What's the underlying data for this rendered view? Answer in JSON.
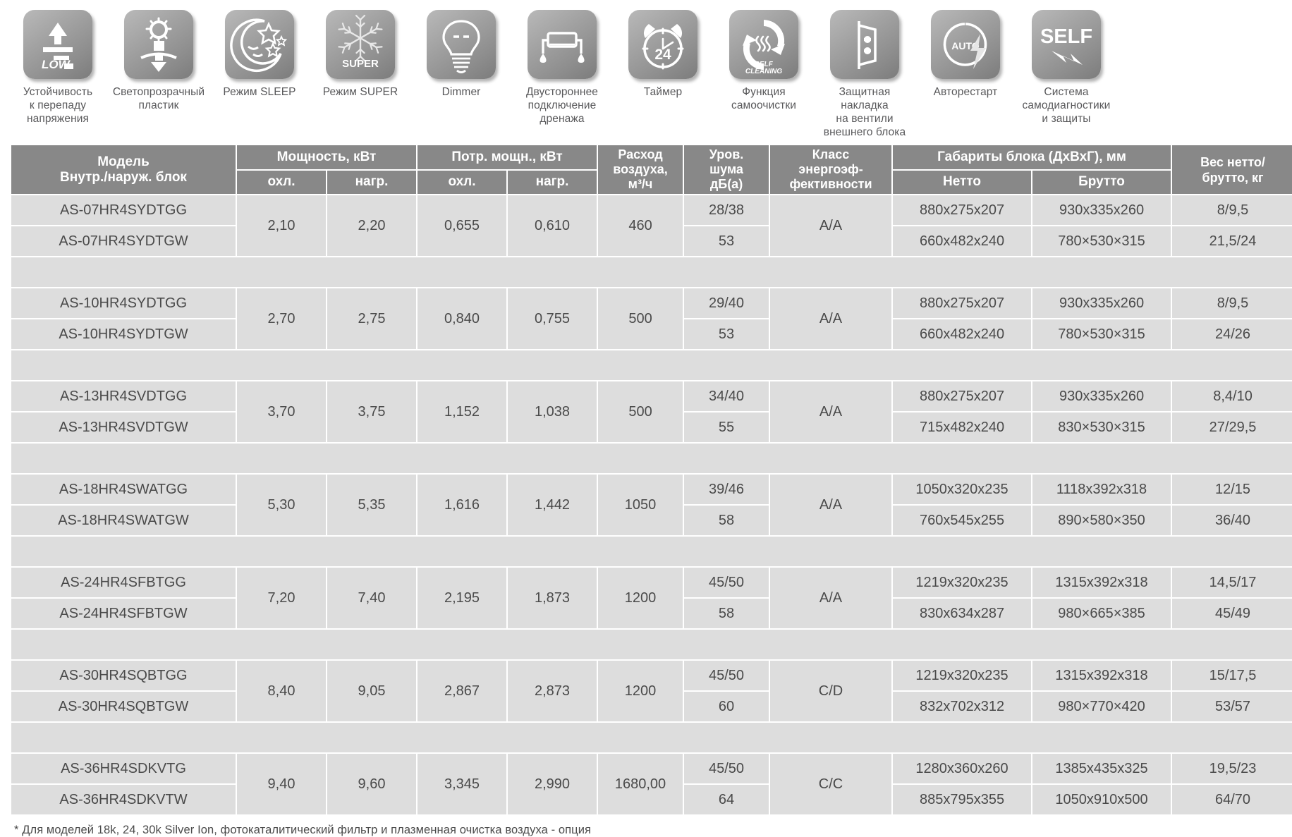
{
  "features": [
    {
      "icon": "voltage-stability-icon",
      "label": "Устойчивость\nк перепаду\nнапряжения"
    },
    {
      "icon": "translucent-plastic-icon",
      "label": "Светопрозрачный\nпластик"
    },
    {
      "icon": "sleep-mode-icon",
      "label": "Режим SLEEP"
    },
    {
      "icon": "super-mode-icon",
      "label": "Режим SUPER"
    },
    {
      "icon": "dimmer-icon",
      "label": "Dimmer"
    },
    {
      "icon": "two-sided-drainage-icon",
      "label": "Двустороннее\nподключение\nдренажа"
    },
    {
      "icon": "timer-icon",
      "label": "Таймер"
    },
    {
      "icon": "self-cleaning-icon",
      "label": "Функция\nсамоочистки"
    },
    {
      "icon": "valve-cover-icon",
      "label": "Защитная накладка\nна вентили\nвнешнего блока"
    },
    {
      "icon": "auto-restart-icon",
      "label": "Авторестарт"
    },
    {
      "icon": "self-diagnostics-icon",
      "label": "Система\nсамодиагностики\nи защиты"
    }
  ],
  "icon_text": {
    "low": "LOW",
    "super": "SUPER",
    "timer": "24",
    "self_cleaning_1": "SELF",
    "self_cleaning_2": "CLEANING",
    "auto": "AUTO",
    "self": "SELF"
  },
  "table": {
    "headers": {
      "model": "Модель\nВнутр./наруж. блок",
      "power": "Мощность, кВт",
      "consumption": "Потр. мощн., кВт",
      "airflow": "Расход\nвоздуха,\nм³/ч",
      "noise": "Уров.\nшума\nдБ(а)",
      "energy_class": "Класс\nэнергоэф-\nфективности",
      "dimensions": "Габариты блока (ДхВхГ), мм",
      "weight": "Вес нетто/\nбрутто, кг",
      "cool_1": "охл.",
      "heat_1": "нагр.",
      "cool_2": "охл.",
      "heat_2": "нагр.",
      "net": "Нетто",
      "gross": "Брутто"
    },
    "rows": [
      {
        "model_indoor": "AS-07HR4SYDTGG",
        "model_outdoor": "AS-07HR4SYDTGW",
        "power_cool": "2,10",
        "power_heat": "2,20",
        "cons_cool": "0,655",
        "cons_heat": "0,610",
        "airflow": "460",
        "noise_indoor": "28/38",
        "noise_outdoor": "53",
        "energy_class": "A/A",
        "net_indoor": "880x275x207",
        "net_outdoor": "660x482x240",
        "gross_indoor": "930x335x260",
        "gross_outdoor": "780×530×315",
        "weight_indoor": "8/9,5",
        "weight_outdoor": "21,5/24"
      },
      {
        "model_indoor": "AS-10HR4SYDTGG",
        "model_outdoor": "AS-10HR4SYDTGW",
        "power_cool": "2,70",
        "power_heat": "2,75",
        "cons_cool": "0,840",
        "cons_heat": "0,755",
        "airflow": "500",
        "noise_indoor": "29/40",
        "noise_outdoor": "53",
        "energy_class": "A/A",
        "net_indoor": "880x275x207",
        "net_outdoor": "660x482x240",
        "gross_indoor": "930x335x260",
        "gross_outdoor": "780×530×315",
        "weight_indoor": "8/9,5",
        "weight_outdoor": "24/26"
      },
      {
        "model_indoor": "AS-13HR4SVDTGG",
        "model_outdoor": "AS-13HR4SVDTGW",
        "power_cool": "3,70",
        "power_heat": "3,75",
        "cons_cool": "1,152",
        "cons_heat": "1,038",
        "airflow": "500",
        "noise_indoor": "34/40",
        "noise_outdoor": "55",
        "energy_class": "A/A",
        "net_indoor": "880x275x207",
        "net_outdoor": "715x482x240",
        "gross_indoor": "930x335x260",
        "gross_outdoor": "830×530×315",
        "weight_indoor": "8,4/10",
        "weight_outdoor": "27/29,5"
      },
      {
        "model_indoor": "AS-18HR4SWATGG",
        "model_outdoor": "AS-18HR4SWATGW",
        "power_cool": "5,30",
        "power_heat": "5,35",
        "cons_cool": "1,616",
        "cons_heat": "1,442",
        "airflow": "1050",
        "noise_indoor": "39/46",
        "noise_outdoor": "58",
        "energy_class": "A/A",
        "net_indoor": "1050x320x235",
        "net_outdoor": "760x545x255",
        "gross_indoor": "1118x392x318",
        "gross_outdoor": "890×580×350",
        "weight_indoor": "12/15",
        "weight_outdoor": "36/40"
      },
      {
        "model_indoor": "AS-24HR4SFBTGG",
        "model_outdoor": "AS-24HR4SFBTGW",
        "power_cool": "7,20",
        "power_heat": "7,40",
        "cons_cool": "2,195",
        "cons_heat": "1,873",
        "airflow": "1200",
        "noise_indoor": "45/50",
        "noise_outdoor": "58",
        "energy_class": "A/A",
        "net_indoor": "1219x320x235",
        "net_outdoor": "830x634x287",
        "gross_indoor": "1315x392x318",
        "gross_outdoor": "980×665×385",
        "weight_indoor": "14,5/17",
        "weight_outdoor": "45/49"
      },
      {
        "model_indoor": "AS-30HR4SQBTGG",
        "model_outdoor": "AS-30HR4SQBTGW",
        "power_cool": "8,40",
        "power_heat": "9,05",
        "cons_cool": "2,867",
        "cons_heat": "2,873",
        "airflow": "1200",
        "noise_indoor": "45/50",
        "noise_outdoor": "60",
        "energy_class": "C/D",
        "net_indoor": "1219x320x235",
        "net_outdoor": "832x702x312",
        "gross_indoor": "1315x392x318",
        "gross_outdoor": "980×770×420",
        "weight_indoor": "15/17,5",
        "weight_outdoor": "53/57"
      },
      {
        "model_indoor": "AS-36HR4SDKVTG",
        "model_outdoor": "AS-36HR4SDKVTW",
        "power_cool": "9,40",
        "power_heat": "9,60",
        "cons_cool": "3,345",
        "cons_heat": "2,990",
        "airflow": "1680,00",
        "noise_indoor": "45/50",
        "noise_outdoor": "64",
        "energy_class": "C/C",
        "net_indoor": "1280x360x260",
        "net_outdoor": "885x795x355",
        "gross_indoor": "1385x435x325",
        "gross_outdoor": "1050x910x500",
        "weight_indoor": "19,5/23",
        "weight_outdoor": "64/70"
      }
    ]
  },
  "footnote": "* Для моделей 18k, 24, 30k Silver Ion, фотокаталитический фильтр и плазменная очистка воздуха - опция",
  "colors": {
    "header_bg": "#888888",
    "cell_bg": "#dddddd",
    "header_text": "#ffffff",
    "body_text": "#4a4a4a",
    "label_text": "#58585a",
    "page_bg": "#ffffff"
  }
}
